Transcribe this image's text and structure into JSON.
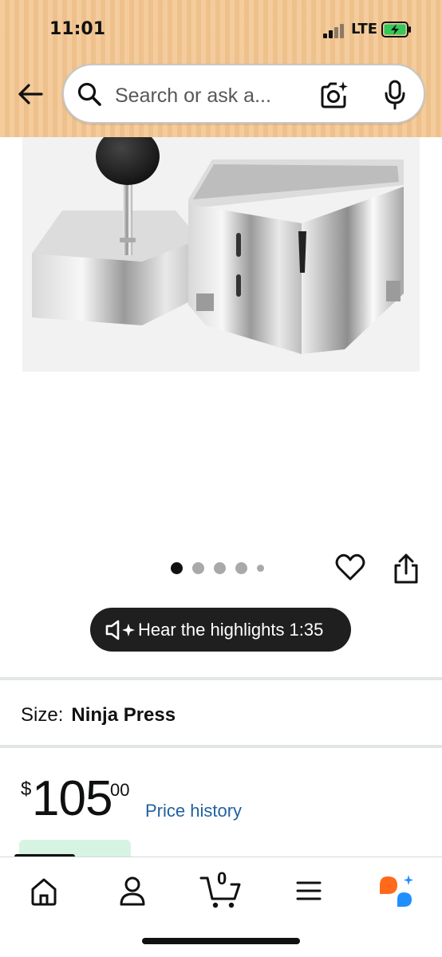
{
  "status": {
    "time": "11:01",
    "network": "LTE"
  },
  "search": {
    "placeholder": "Search or ask a..."
  },
  "carousel": {
    "total": 5,
    "active": 1
  },
  "audio": {
    "label": "Hear the highlights 1:35"
  },
  "size": {
    "label": "Size:",
    "value": "Ninja Press"
  },
  "price": {
    "currency": "$",
    "whole": "105",
    "fraction": "00",
    "history_label": "Price history"
  },
  "cart": {
    "count": "0"
  },
  "icons": [
    "back-arrow-icon",
    "search-icon",
    "camera-icon",
    "mic-icon",
    "heart-icon",
    "share-icon",
    "speaker-icon",
    "home-icon",
    "account-icon",
    "cart-icon",
    "menu-icon",
    "assistant-icon"
  ],
  "colors": {
    "header": "#f3c58f",
    "link": "#2162a1",
    "assistant_orange": "#ff6a1a",
    "assistant_blue": "#1f8fff"
  }
}
